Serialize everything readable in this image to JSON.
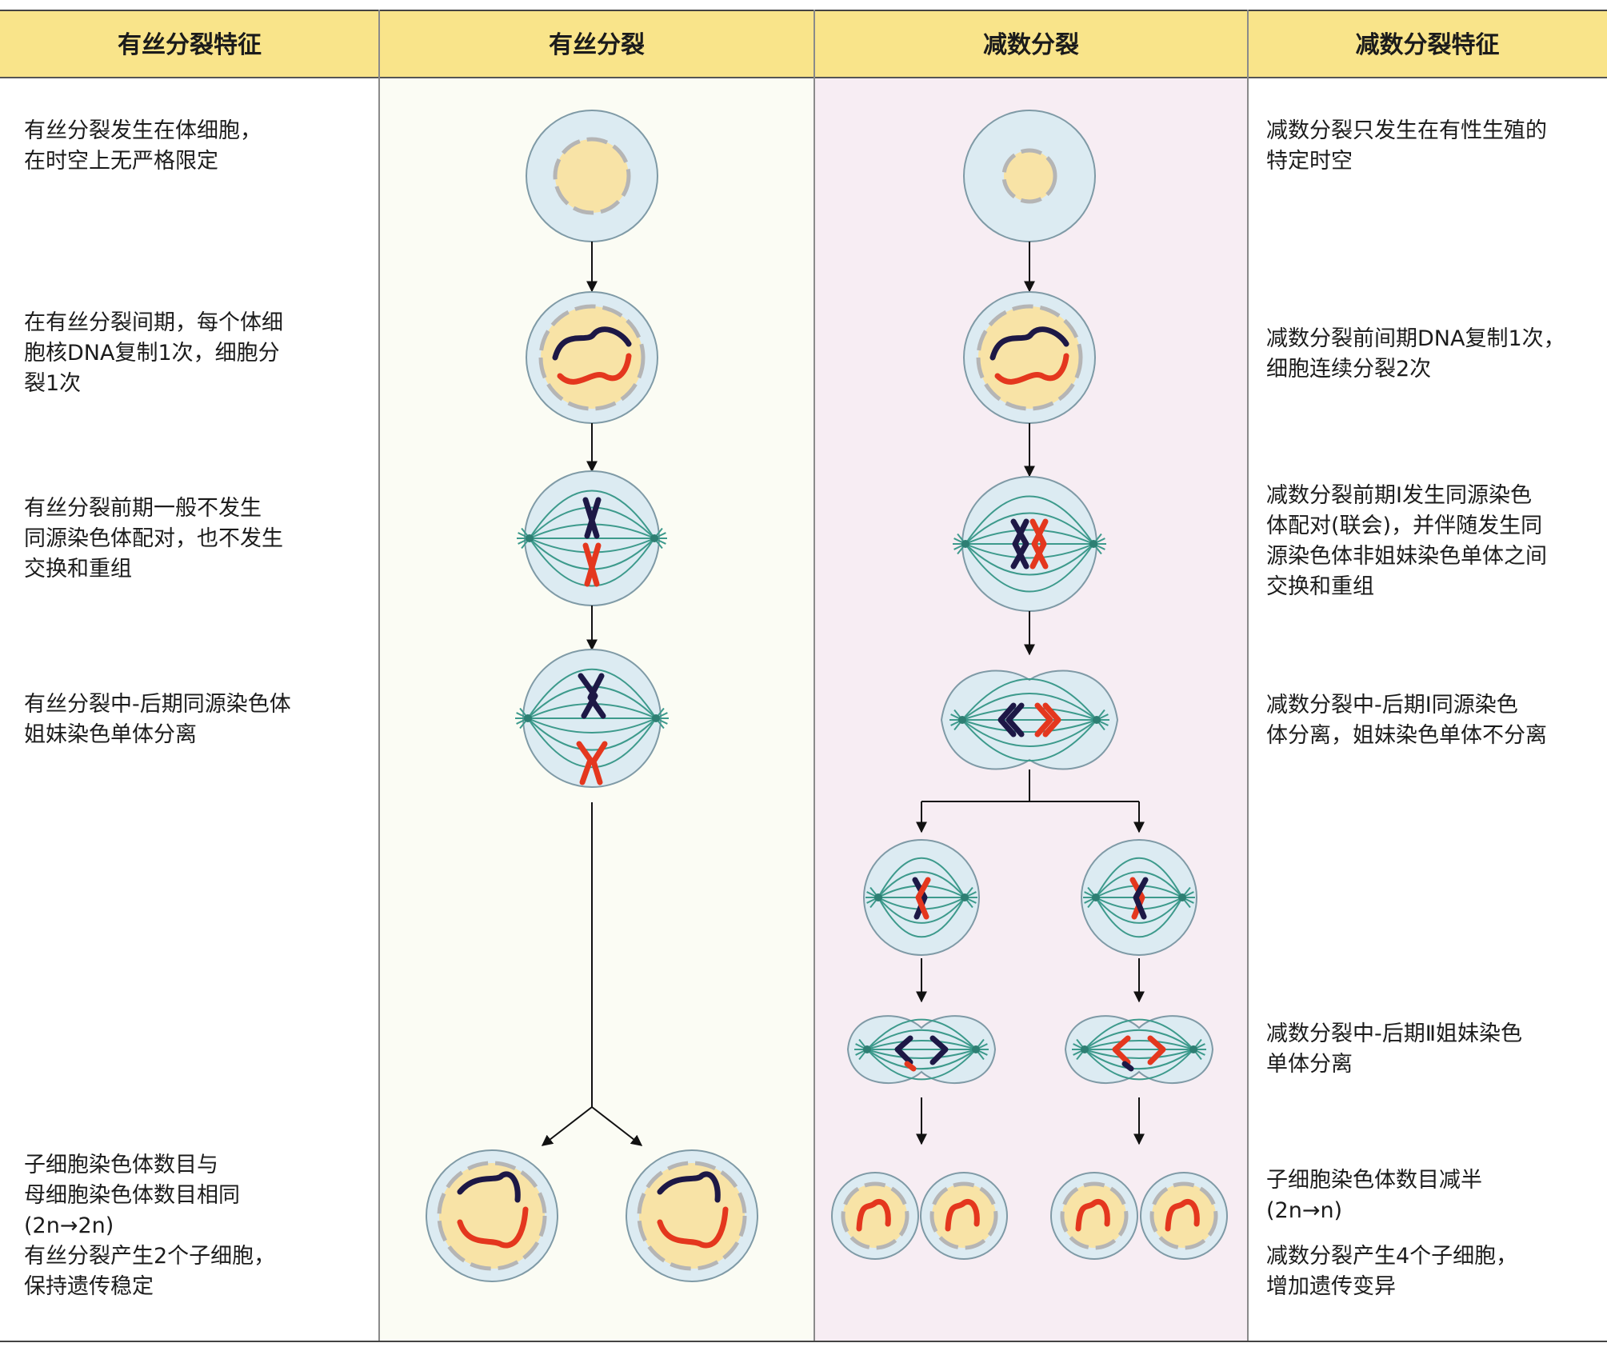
{
  "headers": {
    "mitosis_features": "有丝分裂特征",
    "mitosis": "有丝分裂",
    "meiosis": "减数分裂",
    "meiosis_features": "减数分裂特征"
  },
  "mitosis_notes": [
    "有丝分裂发生在体细胞，\n在时空上无严格限定",
    "在有丝分裂间期，每个体细\n胞核DNA复制1次，细胞分\n裂1次",
    "有丝分裂前期一般不发生\n同源染色体配对，也不发生\n交换和重组",
    "有丝分裂中-后期同源染色体\n姐妹染色单体分离",
    "子细胞染色体数目与\n母细胞染色体数目相同\n(2n→2n)\n有丝分裂产生2个子细胞，\n保持遗传稳定"
  ],
  "meiosis_notes": [
    "减数分裂只发生在有性生殖的\n特定时空",
    "减数分裂前间期DNA复制1次，\n细胞连续分裂2次",
    "减数分裂前期Ⅰ发生同源染色\n体配对(联会)，并伴随发生同\n源染色体非姐妹染色单体之间\n交换和重组",
    "减数分裂中-后期Ⅰ同源染色\n体分离，姐妹染色单体不分离",
    "减数分裂中-后期Ⅱ姐妹染色\n单体分离",
    "子细胞染色体数目减半\n(2n→n)",
    "减数分裂产生4个子细胞，\n增加遗传变异"
  ],
  "colors": {
    "header_bg": "#f9e48a",
    "cell_fill": "#dcebf2",
    "nucleus_fill": "#f8e3a6",
    "spindle": "#3d9a8c",
    "chromosome_dark": "#1d1846",
    "chromosome_red": "#e4371e",
    "meiosis_column_bg": "#f7edf3"
  }
}
